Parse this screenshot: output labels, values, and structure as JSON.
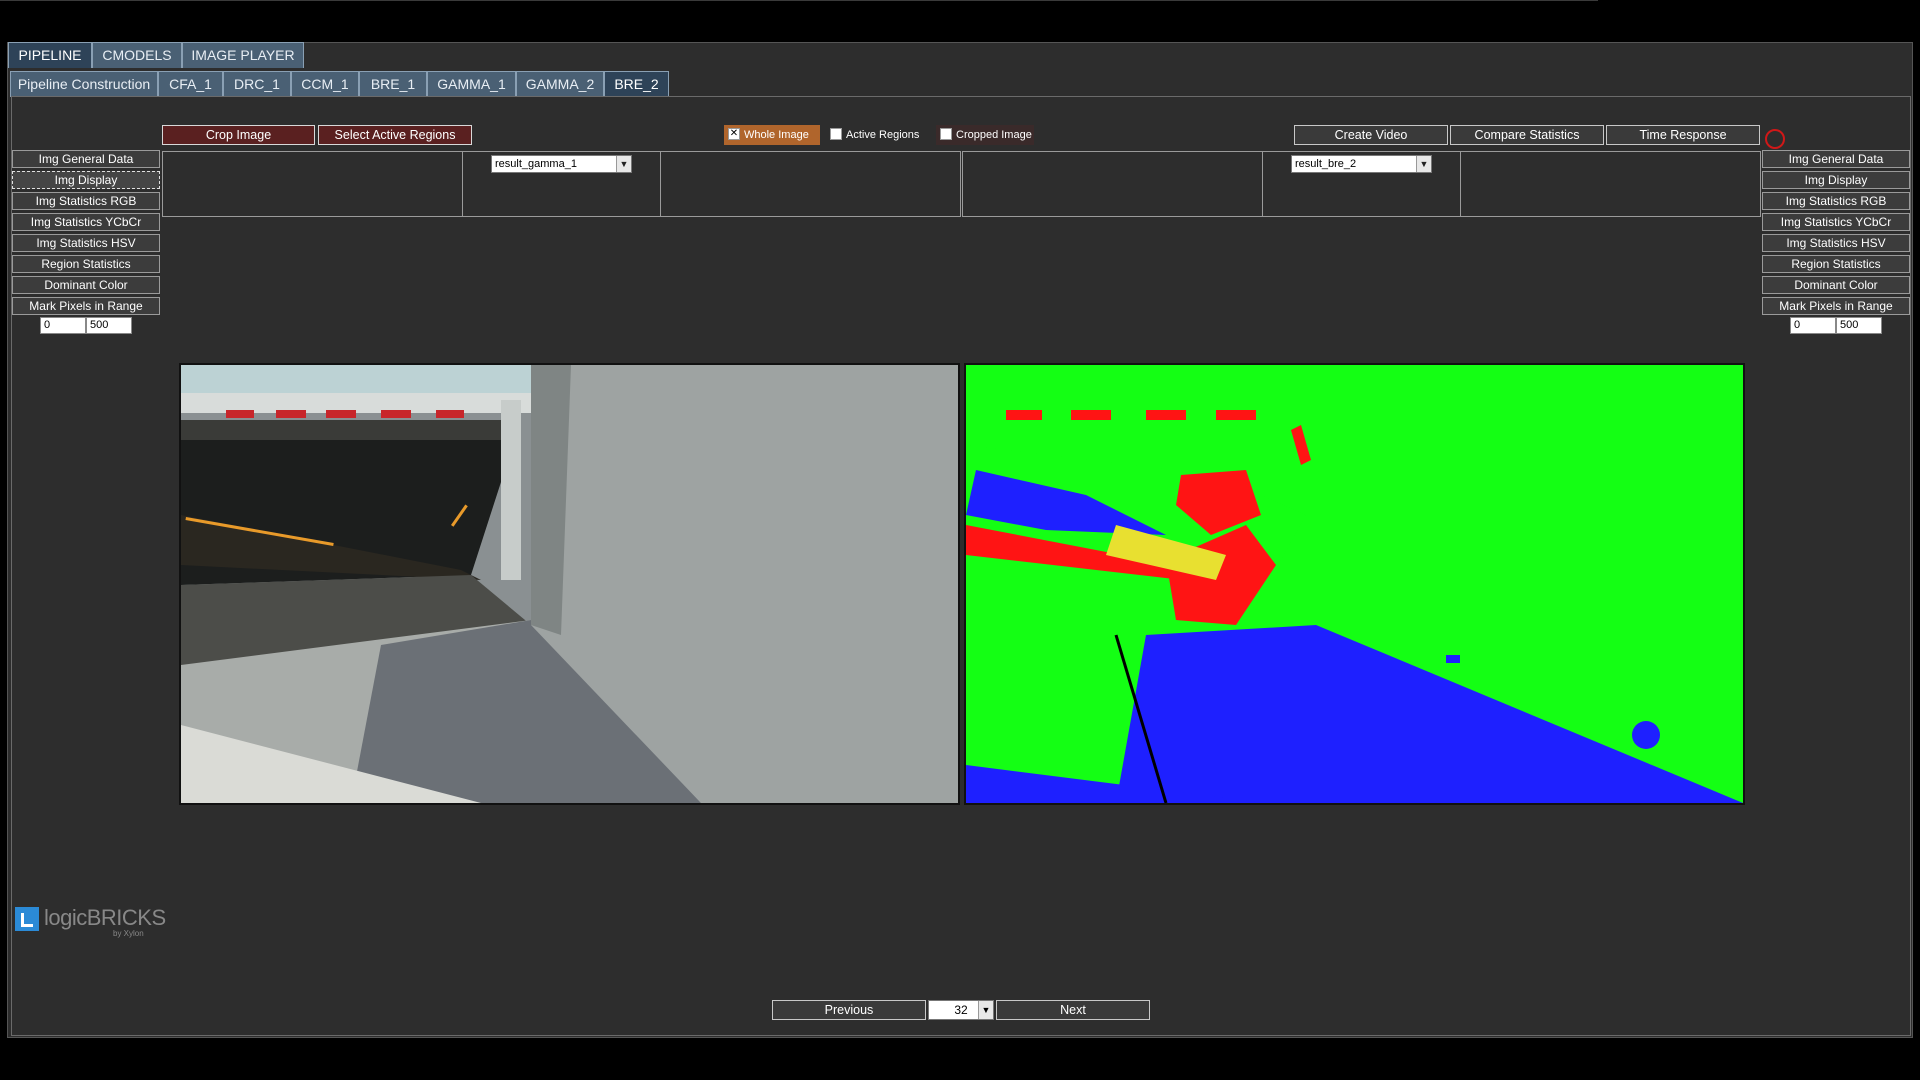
{
  "main_tabs": [
    {
      "label": "PIPELINE",
      "active": true
    },
    {
      "label": "CMODELS",
      "active": false
    },
    {
      "label": "IMAGE PLAYER",
      "active": false
    }
  ],
  "sub_tabs": [
    {
      "label": "Pipeline Construction",
      "active": false
    },
    {
      "label": "CFA_1",
      "active": false
    },
    {
      "label": "DRC_1",
      "active": false
    },
    {
      "label": "CCM_1",
      "active": false
    },
    {
      "label": "BRE_1",
      "active": false
    },
    {
      "label": "GAMMA_1",
      "active": false
    },
    {
      "label": "GAMMA_2",
      "active": false
    },
    {
      "label": "BRE_2",
      "active": true
    }
  ],
  "toolbar": {
    "crop_image": "Crop Image",
    "select_active_regions": "Select Active Regions",
    "whole_image": "Whole Image",
    "active_regions": "Active Regions",
    "cropped_image": "Cropped Image",
    "whole_image_checked": true,
    "active_regions_checked": false,
    "cropped_image_checked": false,
    "create_video": "Create Video",
    "compare_statistics": "Compare Statistics",
    "time_response": "Time Response"
  },
  "side_menu": {
    "items": [
      "Img General Data",
      "Img Display",
      "Img Statistics RGB",
      "Img Statistics YCbCr",
      "Img Statistics HSV",
      "Region Statistics",
      "Dominant Color",
      "Mark Pixels in Range"
    ],
    "range_min": "0",
    "range_max": "500"
  },
  "left_view": {
    "selected_result": "result_gamma_1"
  },
  "right_view": {
    "selected_result": "result_bre_2"
  },
  "navigation": {
    "previous": "Previous",
    "next": "Next",
    "frame": "32"
  },
  "logo": {
    "brand": "logicBRICKS",
    "sub": "by Xylon"
  },
  "colors": {
    "tab_bg": "#4a6074",
    "tab_active_bg": "#2e4358",
    "crop_btn_bg": "#5a2020",
    "whole_image_bg": "#b0652c",
    "panel_bg": "#2d2d2d",
    "record_indicator": "#d01818"
  }
}
